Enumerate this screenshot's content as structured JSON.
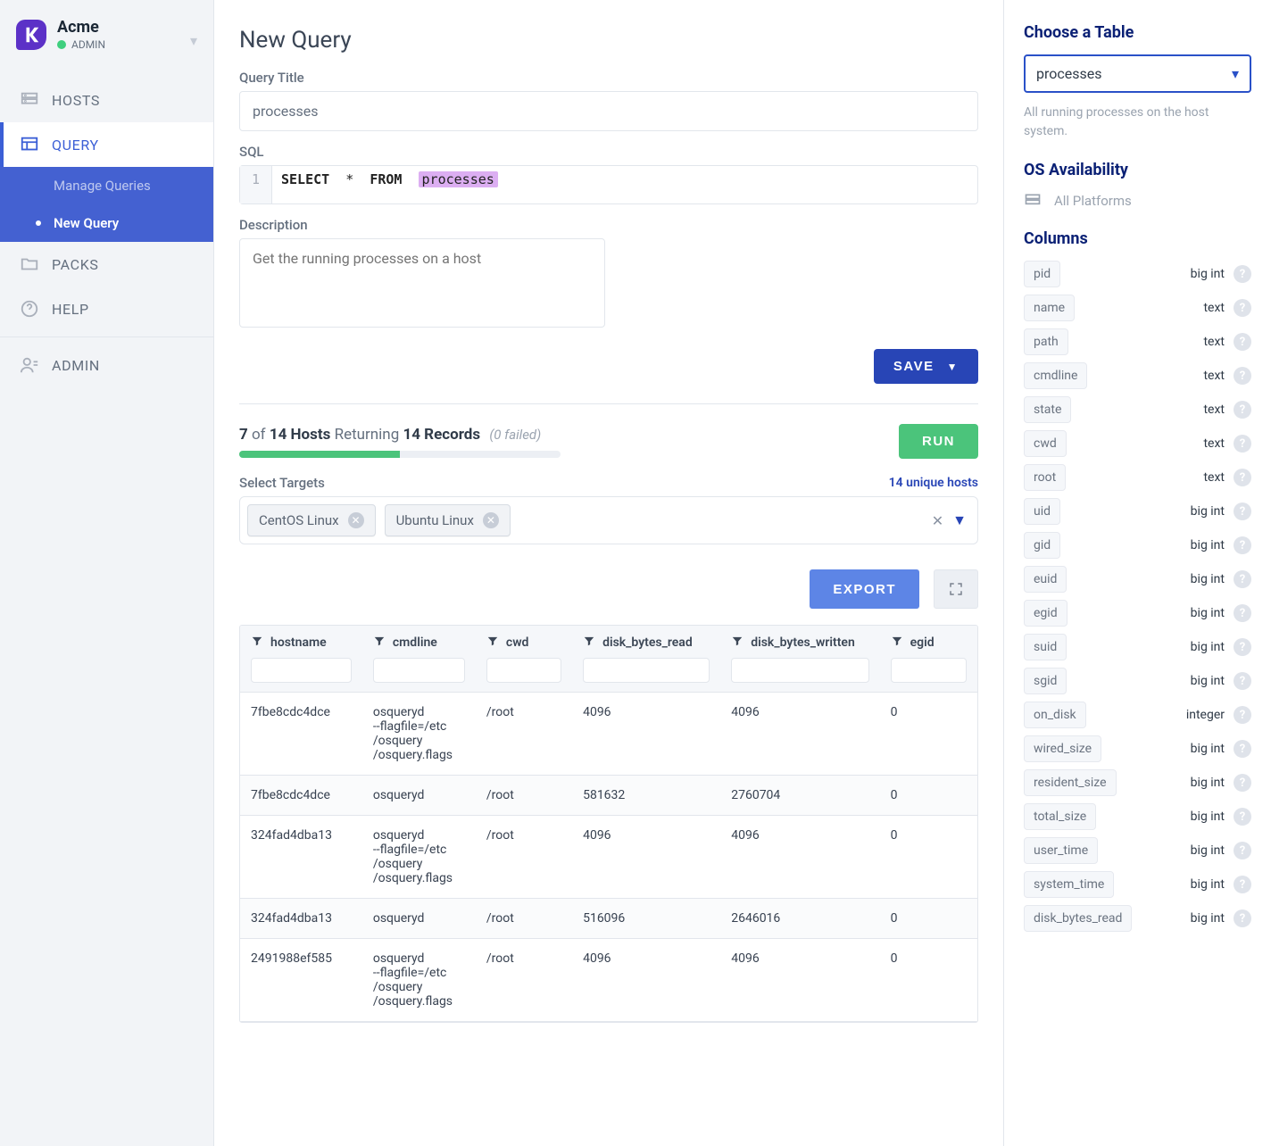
{
  "org": {
    "name": "Acme",
    "role": "ADMIN"
  },
  "nav": {
    "hosts": "HOSTS",
    "query": "QUERY",
    "query_sub": {
      "manage": "Manage Queries",
      "new": "New Query"
    },
    "packs": "PACKS",
    "help": "HELP",
    "admin": "ADMIN"
  },
  "page": {
    "title": "New Query",
    "query_title_label": "Query Title",
    "query_title_value": "processes",
    "sql_label": "SQL",
    "sql_line_no": "1",
    "sql_kw1": "SELECT",
    "sql_star": "*",
    "sql_kw2": "FROM",
    "sql_table": "processes",
    "description_label": "Description",
    "description_placeholder": "Get the running processes on a host",
    "save_label": "SAVE"
  },
  "hosts_status": {
    "progress_count": "7",
    "of_word": "of",
    "total": "14 Hosts",
    "returning": "Returning",
    "records": "14 Records",
    "failed": "(0 failed)",
    "progress_percent": 50,
    "run_label": "RUN"
  },
  "targets": {
    "label": "Select Targets",
    "count": "14 unique hosts",
    "chips": [
      "CentOS Linux",
      "Ubuntu Linux"
    ]
  },
  "actions": {
    "export": "EXPORT"
  },
  "table": {
    "columns": [
      "hostname",
      "cmdline",
      "cwd",
      "disk_bytes_read",
      "disk_bytes_written",
      "egid"
    ],
    "rows": [
      {
        "hostname": "7fbe8cdc4dce",
        "cmdline": "osqueryd --flagfile=/etc/osquery/osquery.flags",
        "cwd": "/root",
        "disk_bytes_read": "4096",
        "disk_bytes_written": "4096",
        "egid": "0"
      },
      {
        "hostname": "7fbe8cdc4dce",
        "cmdline": "osqueryd",
        "cwd": "/root",
        "disk_bytes_read": "581632",
        "disk_bytes_written": "2760704",
        "egid": "0"
      },
      {
        "hostname": "324fad4dba13",
        "cmdline": "osqueryd --flagfile=/etc/osquery/osquery.flags",
        "cwd": "/root",
        "disk_bytes_read": "4096",
        "disk_bytes_written": "4096",
        "egid": "0"
      },
      {
        "hostname": "324fad4dba13",
        "cmdline": "osqueryd",
        "cwd": "/root",
        "disk_bytes_read": "516096",
        "disk_bytes_written": "2646016",
        "egid": "0"
      },
      {
        "hostname": "2491988ef585",
        "cmdline": "osqueryd --flagfile=/etc/osquery/osquery.flags",
        "cwd": "/root",
        "disk_bytes_read": "4096",
        "disk_bytes_written": "4096",
        "egid": "0"
      }
    ]
  },
  "rail": {
    "choose_label": "Choose a Table",
    "selected_table": "processes",
    "table_desc": "All running processes on the host system.",
    "os_label": "OS Availability",
    "os_value": "All Platforms",
    "columns_label": "Columns",
    "columns": [
      {
        "name": "pid",
        "type": "big int"
      },
      {
        "name": "name",
        "type": "text"
      },
      {
        "name": "path",
        "type": "text"
      },
      {
        "name": "cmdline",
        "type": "text"
      },
      {
        "name": "state",
        "type": "text"
      },
      {
        "name": "cwd",
        "type": "text"
      },
      {
        "name": "root",
        "type": "text"
      },
      {
        "name": "uid",
        "type": "big int"
      },
      {
        "name": "gid",
        "type": "big int"
      },
      {
        "name": "euid",
        "type": "big int"
      },
      {
        "name": "egid",
        "type": "big int"
      },
      {
        "name": "suid",
        "type": "big int"
      },
      {
        "name": "sgid",
        "type": "big int"
      },
      {
        "name": "on_disk",
        "type": "integer"
      },
      {
        "name": "wired_size",
        "type": "big int"
      },
      {
        "name": "resident_size",
        "type": "big int"
      },
      {
        "name": "total_size",
        "type": "big int"
      },
      {
        "name": "user_time",
        "type": "big int"
      },
      {
        "name": "system_time",
        "type": "big int"
      },
      {
        "name": "disk_bytes_read",
        "type": "big int"
      }
    ]
  }
}
